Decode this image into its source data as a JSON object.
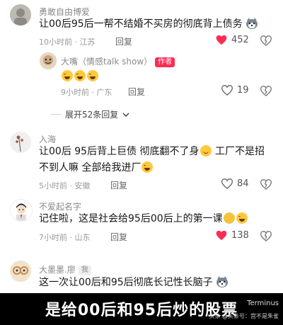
{
  "comments": [
    {
      "username": "勇敢自由博爱",
      "text": "让00后95后一帮不结婚不买房的彻底背上债务",
      "time": "10小时前 · 江苏",
      "reply_label": "回复",
      "likes": "452",
      "liked": true,
      "reply": {
        "username": "大嘴（情感talk show）",
        "badge": "作者",
        "emoji_count": 3,
        "time": "9小时前 · 广东",
        "reply_label": "回复",
        "likes": "19"
      },
      "expand_label": "展开52条回复"
    },
    {
      "username": "入海",
      "text_line1": "让00后 95后背上巨债 彻底翻不了身",
      "text_line1_tail": " 工厂不是招",
      "text_line2": "不到人嘛 全部给我进厂",
      "time": "5小时前 · 安徽",
      "reply_label": "回复",
      "likes": "84",
      "liked": false
    },
    {
      "username": "不爱起名字",
      "text": "记住啦，这是社会给95后00后上的第一课",
      "time": "7小时前 · 山东",
      "reply_label": "回复",
      "likes": "138",
      "liked": true
    },
    {
      "username": "大墨墨.廖",
      "badge": "我",
      "text": "这一次让00后和95后彻底长记性长脑子"
    }
  ],
  "caption": "是给00后和95后炒的股票",
  "watermark": {
    "line1": "Terminus",
    "line2": "头条 @头条号：宫不是朱雀"
  },
  "colors": {
    "like_red": "#fe2c55",
    "author_badge": "#fe2c55"
  }
}
